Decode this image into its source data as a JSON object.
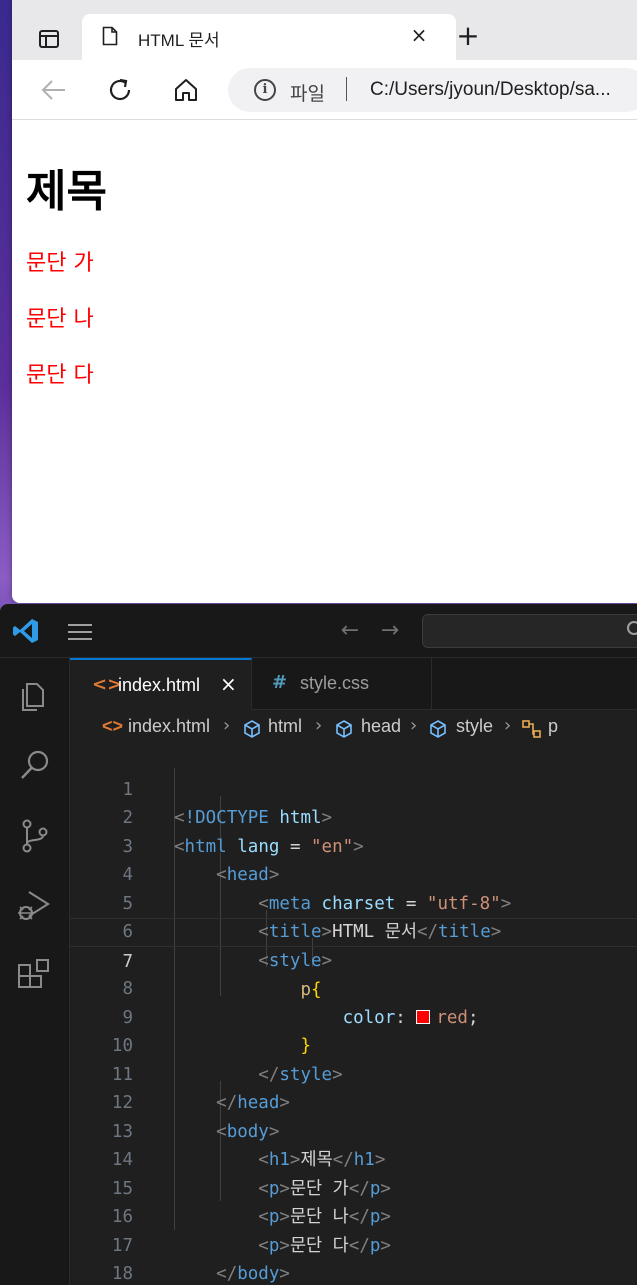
{
  "browser": {
    "tab_title": "HTML 문서",
    "tab_close": "×",
    "new_tab": "+",
    "address_scheme": "파일",
    "address_url": "C:/Users/jyoun/Desktop/sa...",
    "page": {
      "heading": "제목",
      "paragraphs": [
        "문단 가",
        "문단 나",
        "문단 다"
      ],
      "paragraph_color": "#ff0000"
    }
  },
  "vscode": {
    "tabs": [
      {
        "icon": "<>",
        "label": "index.html",
        "active": true,
        "close": "×"
      },
      {
        "icon": "#",
        "label": "style.css",
        "active": false
      }
    ],
    "breadcrumbs": [
      "index.html",
      "html",
      "head",
      "style",
      "p"
    ],
    "accent": "#0078d4",
    "code_lines": [
      {
        "n": "1"
      },
      {
        "n": "2"
      },
      {
        "n": "3"
      },
      {
        "n": "4"
      },
      {
        "n": "5"
      },
      {
        "n": "6"
      },
      {
        "n": "7"
      },
      {
        "n": "8"
      },
      {
        "n": "9"
      },
      {
        "n": "10"
      },
      {
        "n": "11"
      },
      {
        "n": "12"
      },
      {
        "n": "13"
      },
      {
        "n": "14"
      },
      {
        "n": "15"
      },
      {
        "n": "16"
      },
      {
        "n": "17"
      },
      {
        "n": "18"
      }
    ],
    "code": {
      "doctype": "!DOCTYPE",
      "html": "html",
      "lang_attr": "lang",
      "eq": " = ",
      "lang_val": "\"en\"",
      "head": "head",
      "meta": "meta",
      "charset_attr": "charset",
      "charset_val": "\"utf-8\"",
      "title": "title",
      "title_text": "HTML 문서",
      "style": "style",
      "selector": "p",
      "open_brace": "{",
      "close_brace": "}",
      "prop": "color",
      "colon": ":",
      "value": "red",
      "semi": ";",
      "body": "body",
      "h1": "h1",
      "h1_text": "제목",
      "p": "p",
      "p1": "문단 가",
      "p2": "문단 나",
      "p3": "문단 다"
    }
  }
}
